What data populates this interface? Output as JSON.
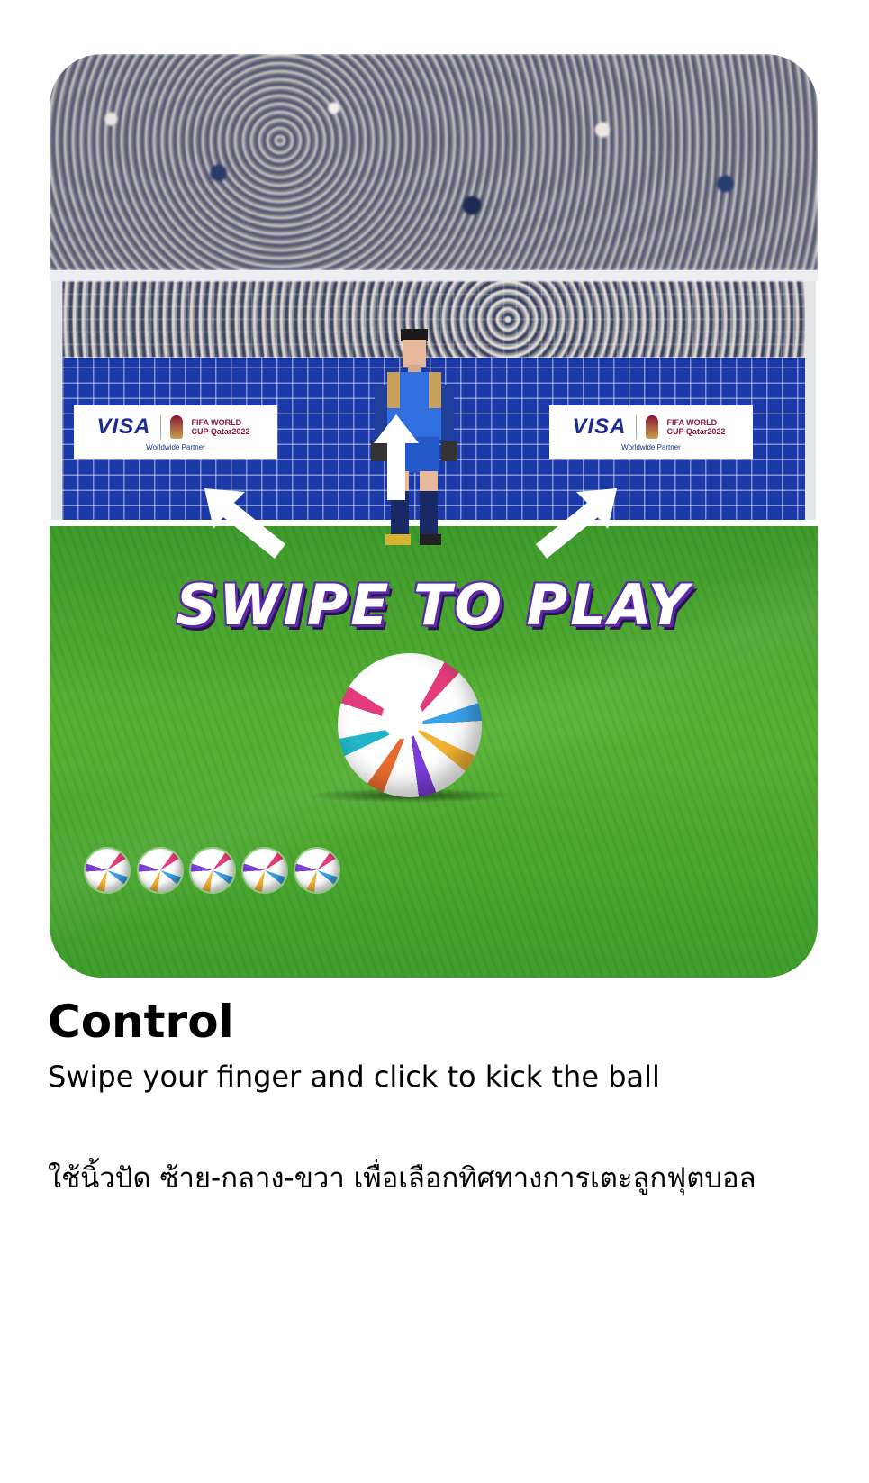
{
  "game_card": {
    "sponsor_left": {
      "brand": "VISA",
      "event": "FIFA WORLD CUP Qatar2022",
      "tagline": "Worldwide Partner"
    },
    "sponsor_right": {
      "brand": "VISA",
      "event": "FIFA WORLD CUP Qatar2022",
      "tagline": "Worldwide Partner"
    },
    "prompt": "SWIPE TO PLAY",
    "remaining_balls": 5,
    "colors": {
      "pitch": "#4fa82f",
      "board": "#1b3aa8",
      "prompt_outline": "#5b2aa6"
    },
    "icons": [
      "arrow-up-icon",
      "arrow-up-left-icon",
      "arrow-up-right-icon",
      "soccer-ball-icon"
    ]
  },
  "instructions": {
    "title": "Control",
    "subtitle": "Swipe your finger and click to kick the ball",
    "thai_text": "ใช้นิ้วปัด ซ้าย-กลาง-ขวา เพื่อเลือกทิศทางการเตะลูกฟุตบอล"
  }
}
